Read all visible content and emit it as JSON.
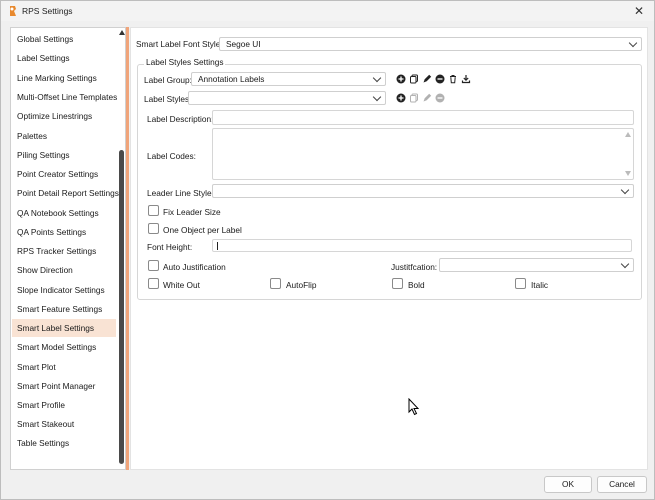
{
  "window": {
    "title": "RPS Settings"
  },
  "sidebar": {
    "items": [
      {
        "label": "Global Settings"
      },
      {
        "label": "Label Settings"
      },
      {
        "label": "Line Marking Settings"
      },
      {
        "label": "Multi-Offset Line Templates"
      },
      {
        "label": "Optimize Linestrings"
      },
      {
        "label": "Palettes"
      },
      {
        "label": "Piling Settings"
      },
      {
        "label": "Point Creator Settings"
      },
      {
        "label": "Point Detail Report Settings"
      },
      {
        "label": "QA Notebook Settings"
      },
      {
        "label": "QA Points Settings"
      },
      {
        "label": "RPS Tracker Settings"
      },
      {
        "label": "Show Direction"
      },
      {
        "label": "Slope Indicator Settings"
      },
      {
        "label": "Smart Feature Settings"
      },
      {
        "label": "Smart Label Settings",
        "selected": true
      },
      {
        "label": "Smart Model Settings"
      },
      {
        "label": "Smart Plot"
      },
      {
        "label": "Smart Point Manager"
      },
      {
        "label": "Smart Profile"
      },
      {
        "label": "Smart Stakeout"
      },
      {
        "label": "Table Settings"
      }
    ]
  },
  "main": {
    "font_style_label": "Smart Label Font Style:",
    "font_style_value": "Segoe UI",
    "group_title": "Label Styles Settings",
    "label_group_label": "Label Group:",
    "label_group_value": "Annotation Labels",
    "label_styles_label": "Label Styles:",
    "label_styles_value": "",
    "label_description_label": "Label Description:",
    "label_description_value": "",
    "label_codes_label": "Label Codes:",
    "label_codes_value": "",
    "leader_line_style_label": "Leader Line Style:",
    "leader_line_style_value": "",
    "fix_leader_size_label": "Fix Leader Size",
    "one_object_per_label_label": "One Object per Label",
    "font_height_label": "Font Height:",
    "font_height_value": "",
    "auto_justification_label": "Auto Justification",
    "justification_label": "Justitfcation:",
    "justification_value": "",
    "white_out_label": "White Out",
    "autoflip_label": "AutoFlip",
    "bold_label": "Bold",
    "italic_label": "Italic",
    "checkboxes": {
      "fix_leader_size": false,
      "one_object_per_label": false,
      "auto_justification": false,
      "white_out": false,
      "autoflip": false,
      "bold": false,
      "italic": false
    }
  },
  "footer": {
    "ok_label": "OK",
    "cancel_label": "Cancel"
  },
  "colors": {
    "accent": "#f0a47a",
    "selected_bg": "#f9e3d4"
  }
}
